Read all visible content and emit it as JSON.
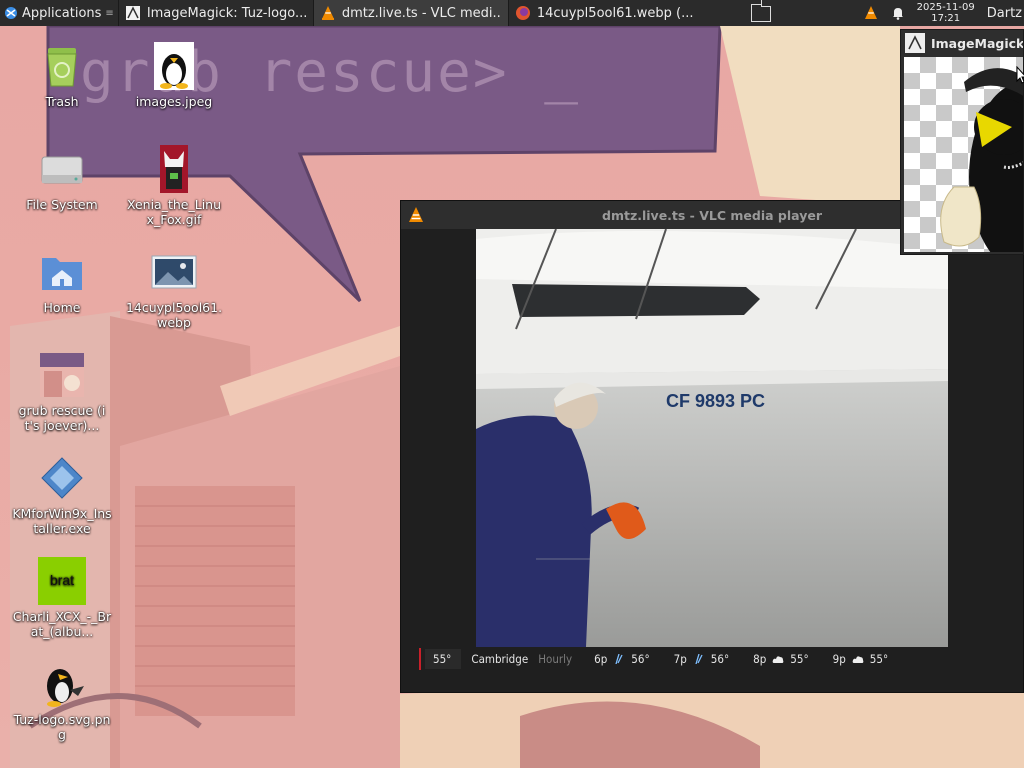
{
  "taskbar": {
    "apps_label": "Applications",
    "tasks": [
      {
        "title": "ImageMagick: Tuz-logo...",
        "icon": "imagemagick-icon"
      },
      {
        "title": "dmtz.live.ts - VLC medi...",
        "icon": "vlc-icon"
      },
      {
        "title": "14cuypl5ool61.webp (...",
        "icon": "firefox-icon"
      }
    ],
    "clock_date": "2025-11-09",
    "clock_time": "17:21",
    "user": "Dartz"
  },
  "wallpaper": {
    "prompt_text": "grub rescue> _"
  },
  "desktop_icons": [
    {
      "label": "Trash",
      "icon": "trash-icon"
    },
    {
      "label": "images.jpeg",
      "icon": "tux-image-icon"
    },
    {
      "label": "File System",
      "icon": "drive-icon"
    },
    {
      "label": "Xenia_the_Linux_Fox.gif",
      "icon": "fox-image-icon"
    },
    {
      "label": "Home",
      "icon": "home-folder-icon"
    },
    {
      "label": "14cuypl5ool61.webp",
      "icon": "image-file-icon"
    },
    {
      "label": "grub rescue (it's joever)...",
      "icon": "image-file-icon"
    },
    {
      "label": "KMforWin9x_Installer.exe",
      "icon": "exe-file-icon"
    },
    {
      "label": "Charli_XCX_-_Brat_(albu...",
      "icon": "brat-image-icon"
    },
    {
      "label": "Tuz-logo.svg.png",
      "icon": "tuz-image-icon"
    }
  ],
  "vlc": {
    "title": "dmtz.live.ts - VLC media player",
    "video_overlay_text": "CF 9893 PC",
    "ticker": {
      "current_temp": "55°",
      "location": "Cambridge",
      "mode": "Hourly",
      "slots": [
        {
          "time": "6p",
          "temp": "56°",
          "weather": "wind-icon"
        },
        {
          "time": "7p",
          "temp": "56°",
          "weather": "wind-icon"
        },
        {
          "time": "8p",
          "temp": "55°",
          "weather": "cloud-icon"
        },
        {
          "time": "9p",
          "temp": "55°",
          "weather": "cloud-icon"
        }
      ]
    }
  },
  "imagemagick": {
    "title": "ImageMagick: Tuz-logo.svg.png"
  },
  "colors": {
    "taskbar_bg": "#2b2b2b",
    "wallpaper_pink": "#e8a8a4",
    "wallpaper_purple": "#7a5a86",
    "vlc_orange": "#f08a00"
  }
}
